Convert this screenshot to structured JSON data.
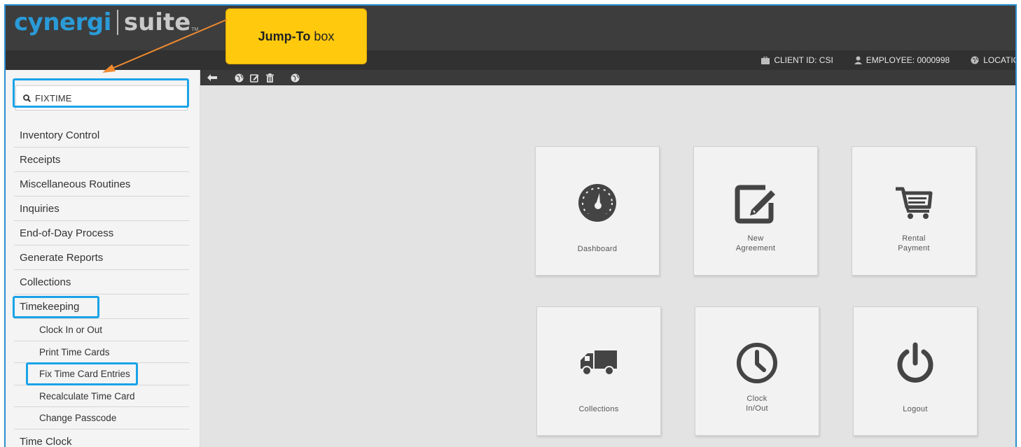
{
  "app": {
    "logo_primary": "cynergi",
    "logo_secondary": "suite",
    "logo_mark": "TM",
    "brand_color": "#2a9bd8"
  },
  "header": {
    "client_id": "CLIENT ID: CSI",
    "employee": "EMPLOYEE: 0000998",
    "location": "LOCATIO"
  },
  "callout": {
    "bold": "Jump-To",
    "rest": "box"
  },
  "search": {
    "value": "FIXTIME"
  },
  "menu": {
    "items": [
      "Inventory Control",
      "Receipts",
      "Miscellaneous Routines",
      "Inquiries",
      "End-of-Day Process",
      "Generate Reports",
      "Collections"
    ],
    "timekeeping": "Timekeeping",
    "sub_items": [
      "Clock In or Out",
      "Print Time Cards",
      "Fix Time Card Entries",
      "Recalculate Time Card",
      "Change Passcode"
    ],
    "last_item": "Time Clock"
  },
  "tiles": [
    {
      "line1": "Dashboard",
      "line2": "",
      "icon": "dashboard-icon"
    },
    {
      "line1": "New",
      "line2": "Agreement",
      "icon": "edit-icon"
    },
    {
      "line1": "Rental",
      "line2": "Payment",
      "icon": "cart-icon"
    },
    {
      "line1": "Collections",
      "line2": "",
      "icon": "truck-icon"
    },
    {
      "line1": "Clock",
      "line2": "In/Out",
      "icon": "clock-icon"
    },
    {
      "line1": "Logout",
      "line2": "",
      "icon": "power-icon"
    }
  ],
  "highlight_color": "#1aa3e8",
  "callout_color": "#ffc90e"
}
